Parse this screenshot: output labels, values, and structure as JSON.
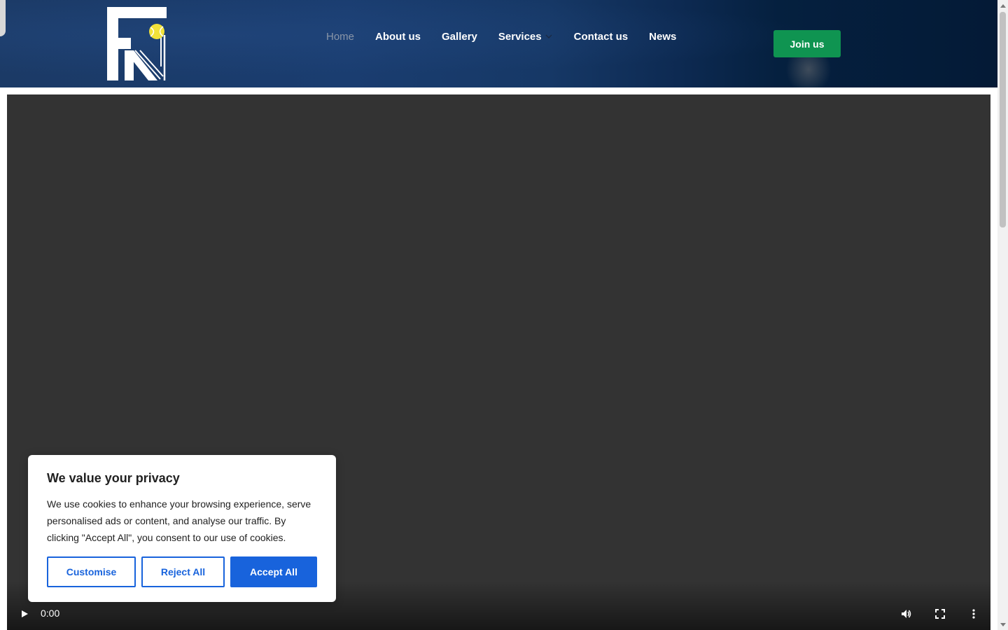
{
  "header": {
    "logo_alt": "FN",
    "nav": [
      {
        "label": "Home",
        "active": true
      },
      {
        "label": "About us"
      },
      {
        "label": "Gallery"
      },
      {
        "label": "Services",
        "has_dropdown": true
      },
      {
        "label": "Contact us"
      },
      {
        "label": "News"
      }
    ],
    "join_label": "Join us"
  },
  "video": {
    "current_time": "0:00",
    "controls": [
      "play-icon",
      "volume-icon",
      "fullscreen-icon",
      "more-icon"
    ]
  },
  "cookie_banner": {
    "title": "We value your privacy",
    "text": "We use cookies to enhance your browsing experience, serve personalised ads or content, and analyse our traffic. By clicking \"Accept All\", you consent to our use of cookies.",
    "customise_label": "Customise",
    "reject_label": "Reject All",
    "accept_label": "Accept All"
  },
  "colors": {
    "header_bg": "#1a3d70",
    "join_button": "#0f9451",
    "cookie_accent": "#1863dc",
    "video_bg": "#333333",
    "logo_ball": "#f2e23a"
  }
}
